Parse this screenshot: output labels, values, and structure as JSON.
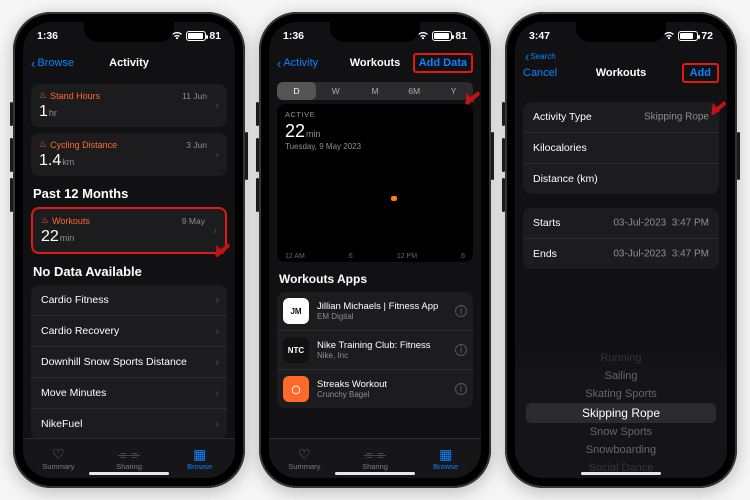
{
  "screen1": {
    "status_time": "1:36",
    "battery_pct": 81,
    "nav_back": "Browse",
    "nav_title": "Activity",
    "card_stand": {
      "label": "Stand Hours",
      "value": "1",
      "unit": "hr",
      "date": "11 Jun"
    },
    "card_cycling": {
      "label": "Cycling Distance",
      "value": "1.4",
      "unit": "km",
      "date": "3 Jun"
    },
    "section_past": "Past 12 Months",
    "card_workouts": {
      "label": "Workouts",
      "value": "22",
      "unit": "min",
      "date": "9 May"
    },
    "section_nodata": "No Data Available",
    "rows": [
      "Cardio Fitness",
      "Cardio Recovery",
      "Downhill Snow Sports Distance",
      "Move Minutes",
      "NikeFuel"
    ],
    "tabs": {
      "summary": "Summary",
      "sharing": "Sharing",
      "browse": "Browse"
    }
  },
  "screen2": {
    "status_time": "1:36",
    "battery_pct": 81,
    "nav_back": "Activity",
    "nav_title": "Workouts",
    "nav_right": "Add Data",
    "seg": [
      "D",
      "W",
      "M",
      "6M",
      "Y"
    ],
    "active_label": "ACTIVE",
    "active_value": "22",
    "active_unit": "min",
    "active_date": "Tuesday, 9 May 2023",
    "axis": [
      "12 AM",
      "6",
      "12 PM",
      "6"
    ],
    "apps_header": "Workouts Apps",
    "apps": [
      {
        "name": "Jillian Michaels | Fitness App",
        "sub": "EM Digital",
        "bg": "#ffffff",
        "fg": "#111",
        "ic": "JM"
      },
      {
        "name": "Nike Training Club: Fitness",
        "sub": "Nike, Inc",
        "bg": "#111",
        "fg": "#fff",
        "ic": "NTC"
      },
      {
        "name": "Streaks Workout",
        "sub": "Crunchy Bagel",
        "bg": "#ff6a2a",
        "fg": "#fff",
        "ic": "◯"
      }
    ],
    "tabs": {
      "summary": "Summary",
      "sharing": "Sharing",
      "browse": "Browse"
    }
  },
  "screen3": {
    "status_time": "3:47",
    "battery_pct": 72,
    "search_back": "Search",
    "nav_left": "Cancel",
    "nav_title": "Workouts",
    "nav_right": "Add",
    "fields": {
      "activity_type": {
        "label": "Activity Type",
        "value": "Skipping Rope"
      },
      "kcal": {
        "label": "Kilocalories"
      },
      "distance": {
        "label": "Distance (km)"
      }
    },
    "times": {
      "starts": {
        "label": "Starts",
        "date": "03-Jul-2023",
        "time": "3:47 PM"
      },
      "ends": {
        "label": "Ends",
        "date": "03-Jul-2023",
        "time": "3:47 PM"
      }
    },
    "picker": [
      "Running",
      "Sailing",
      "Skating Sports",
      "Skipping Rope",
      "Snow Sports",
      "Snowboarding",
      "Social Dance"
    ]
  }
}
